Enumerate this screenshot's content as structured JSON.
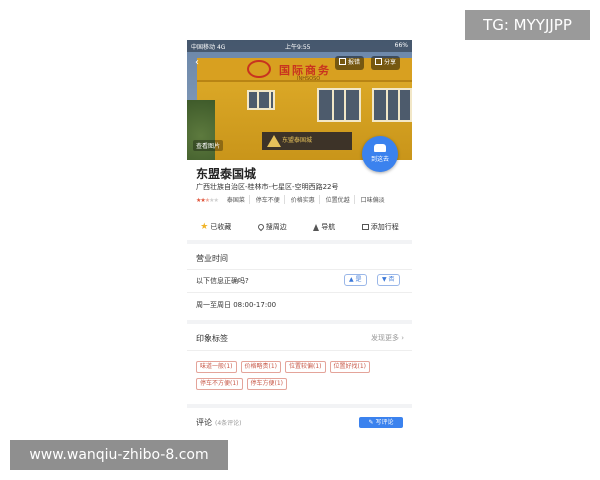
{
  "watermarks": {
    "top_right": "TG: MYYJJPP",
    "bottom_left": "www.wanqiu-zhibo-8.com"
  },
  "status_bar": {
    "carrier": "中国移动",
    "network": "4G",
    "time": "上午9:55",
    "battery": "66%"
  },
  "hero": {
    "back_icon": "chevron-left-icon",
    "report_label": "报错",
    "share_label": "分享",
    "photos_label": "查看图片",
    "building_sign": "国际商务",
    "building_sign_sub": "INHSOSO",
    "gate_sign": "东盟泰国城"
  },
  "route_button": {
    "label": "到这去",
    "icon": "car-icon",
    "color": "#3b82ee"
  },
  "place": {
    "name": "东盟泰国城",
    "address": "广西壮族自治区-桂林市-七星区-空明西路22号",
    "rating": 2.5,
    "meta_tags": [
      "泰国菜",
      "停车不便",
      "价格实惠",
      "位置优越",
      "口味偏淡"
    ]
  },
  "actions": [
    {
      "label": "已收藏",
      "icon": "star-icon"
    },
    {
      "label": "搜周边",
      "icon": "location-pin-icon"
    },
    {
      "label": "导航",
      "icon": "navigation-icon"
    },
    {
      "label": "添加行程",
      "icon": "calendar-icon"
    }
  ],
  "hours_section": {
    "title": "营业时间",
    "question": "以下信息正确吗?",
    "yes_label": "是",
    "no_label": "否",
    "hours": "周一至周日 08:00-17:00"
  },
  "impression_section": {
    "title": "印象标签",
    "more_label": "发现更多",
    "tags": [
      "味道一般(1)",
      "价格略贵(1)",
      "位置较偏(1)",
      "位置好找(1)",
      "停车不方便(1)",
      "停车方便(1)"
    ]
  },
  "review_section": {
    "title": "评论",
    "count_label": "(4条评论)",
    "write_label": "写评论"
  },
  "colors": {
    "accent": "#3b82ee",
    "star": "#f0b429",
    "tag_border": "#e4a49a",
    "rating": "#e0543a"
  }
}
